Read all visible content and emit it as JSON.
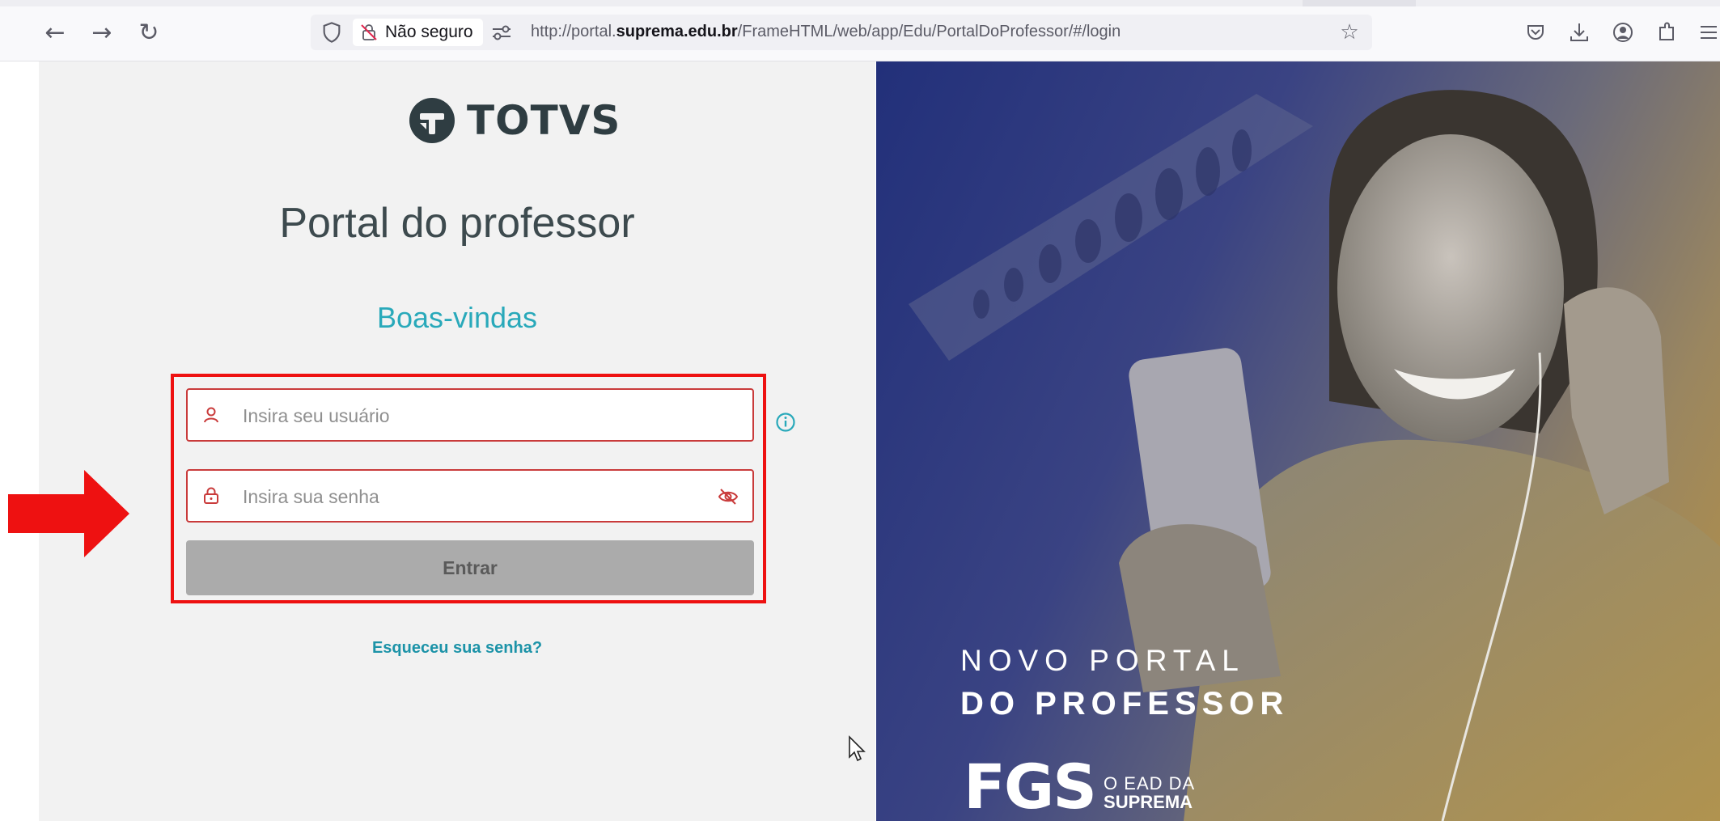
{
  "browser": {
    "security_label": "Não seguro",
    "url_prefix": "http://portal.",
    "url_domain": "suprema.edu.br",
    "url_path": "/FrameHTML/web/app/Edu/PortalDoProfessor/#/login"
  },
  "login": {
    "brand": "TOTVS",
    "title": "Portal do professor",
    "welcome": "Boas-vindas",
    "username_placeholder": "Insira seu usuário",
    "password_placeholder": "Insira sua senha",
    "submit_label": "Entrar",
    "forgot_label": "Esqueceu sua senha?"
  },
  "hero": {
    "line1": "NOVO PORTAL",
    "line2": "DO PROFESSOR",
    "brand_mark": "FGS",
    "brand_sub1": "O EAD DA",
    "brand_sub2": "SUPREMA"
  },
  "colors": {
    "accent": "#29a9ba",
    "link": "#1c93a8",
    "field_border": "#c93b3b",
    "highlight": "#ee1111",
    "button_disabled": "#ababab"
  },
  "icons": [
    "back-arrow-icon",
    "forward-arrow-icon",
    "reload-icon",
    "shield-icon",
    "insecure-lock-icon",
    "permissions-icon",
    "star-icon",
    "pocket-icon",
    "download-icon",
    "account-icon",
    "extensions-icon",
    "menu-icon",
    "user-icon",
    "lock-icon",
    "info-icon",
    "eye-off-icon"
  ]
}
